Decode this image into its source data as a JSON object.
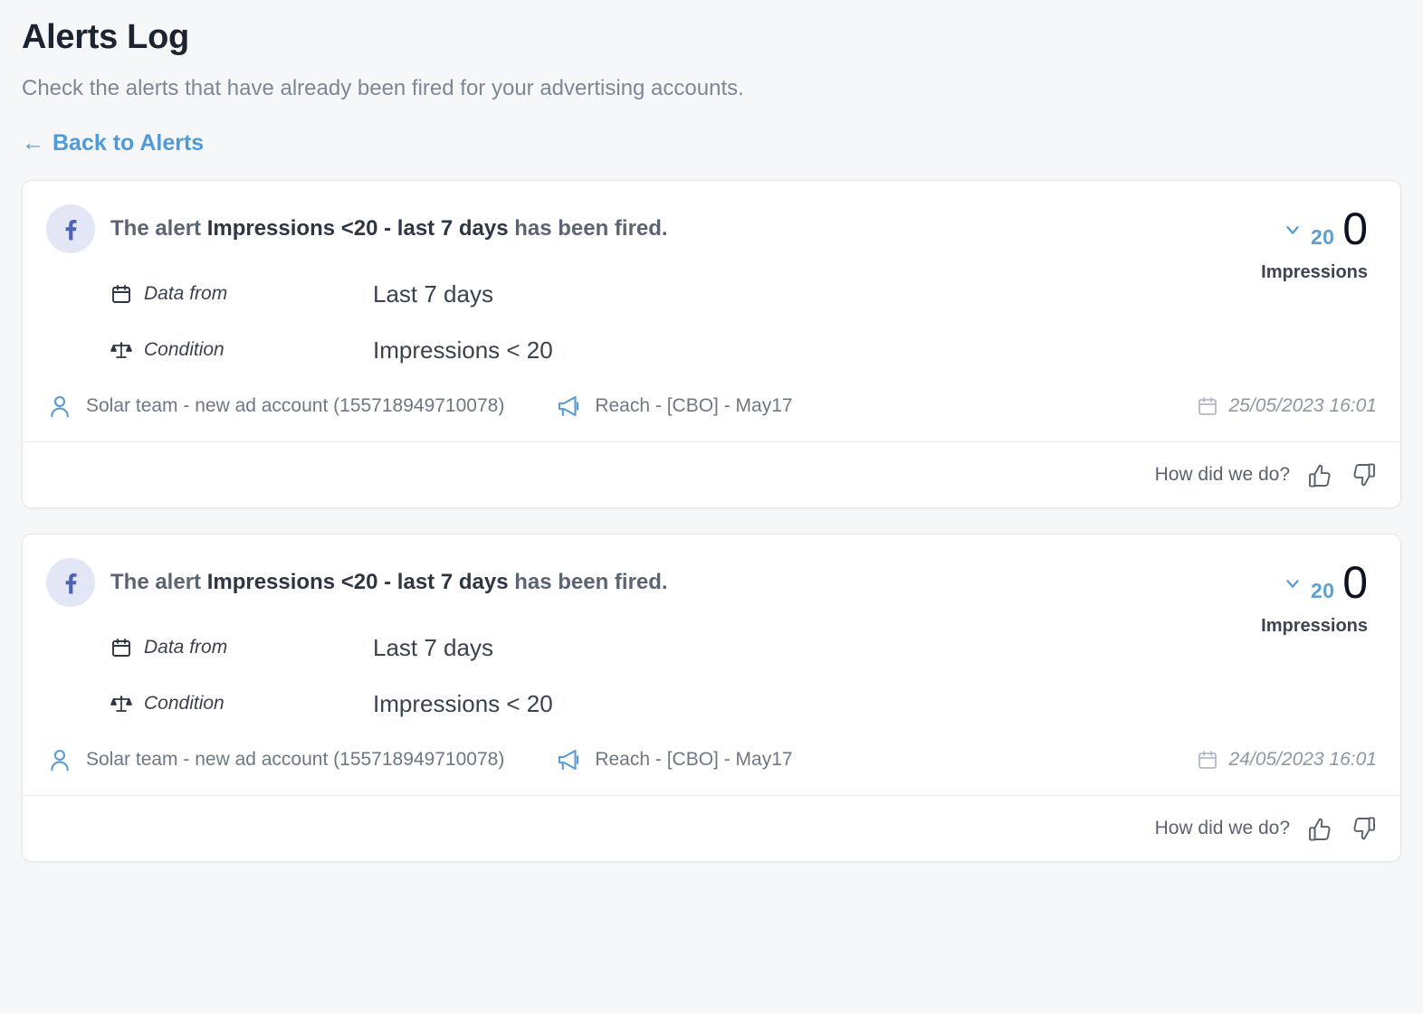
{
  "header": {
    "title": "Alerts Log",
    "subtitle": "Check the alerts that have already been fired for your advertising accounts.",
    "back_link": "Back to Alerts",
    "back_arrow": "←"
  },
  "labels": {
    "data_from": "Data from",
    "condition": "Condition",
    "metric_label": "Impressions",
    "feedback_question": "How did we do?",
    "headline_prefix": "The alert ",
    "headline_suffix": " has been fired."
  },
  "icons": {
    "facebook": "facebook-icon",
    "calendar": "calendar-icon",
    "scales": "scales-icon",
    "person": "person-icon",
    "megaphone": "megaphone-icon",
    "chevron_down": "chevron-down-icon",
    "thumbs_up": "thumbs-up-icon",
    "thumbs_down": "thumbs-down-icon",
    "back_arrow": "arrow-left-icon"
  },
  "colors": {
    "accent_blue": "#4f9ad8",
    "metric_blue": "#5e9fd4",
    "page_bg": "#f6f7f9",
    "card_bg": "#ffffff",
    "card_border": "#e2e6ec",
    "fb_badge_bg": "#e3e7f5",
    "fb_blue": "#4c63b6",
    "text_dark": "#2e3543",
    "text_muted": "#7c8796"
  },
  "alerts": [
    {
      "platform": "facebook",
      "alert_name": "Impressions <20 - last 7 days",
      "data_from": "Last 7 days",
      "condition": "Impressions < 20",
      "threshold": "20",
      "value": "0",
      "metric": "Impressions",
      "account": "Solar team - new ad account (155718949710078)",
      "campaign": "Reach - [CBO] - May17",
      "timestamp": "25/05/2023 16:01"
    },
    {
      "platform": "facebook",
      "alert_name": "Impressions <20 - last 7 days",
      "data_from": "Last 7 days",
      "condition": "Impressions < 20",
      "threshold": "20",
      "value": "0",
      "metric": "Impressions",
      "account": "Solar team - new ad account (155718949710078)",
      "campaign": "Reach - [CBO] - May17",
      "timestamp": "24/05/2023 16:01"
    }
  ]
}
